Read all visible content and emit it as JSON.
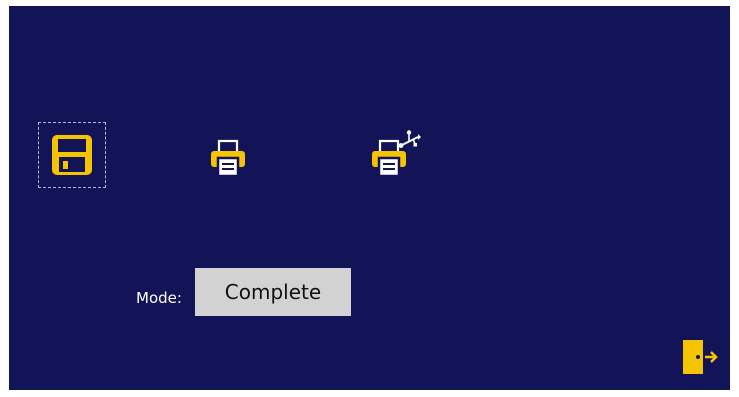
{
  "icons": {
    "save": "floppy-disk-icon",
    "print": "printer-icon",
    "print_usb": "printer-usb-icon",
    "exit": "exit-door-icon"
  },
  "mode": {
    "label": "Mode:",
    "value": "Complete"
  },
  "colors": {
    "background": "#131457",
    "icon_yellow": "#f5c400",
    "mode_field": "#d2d2d2"
  }
}
